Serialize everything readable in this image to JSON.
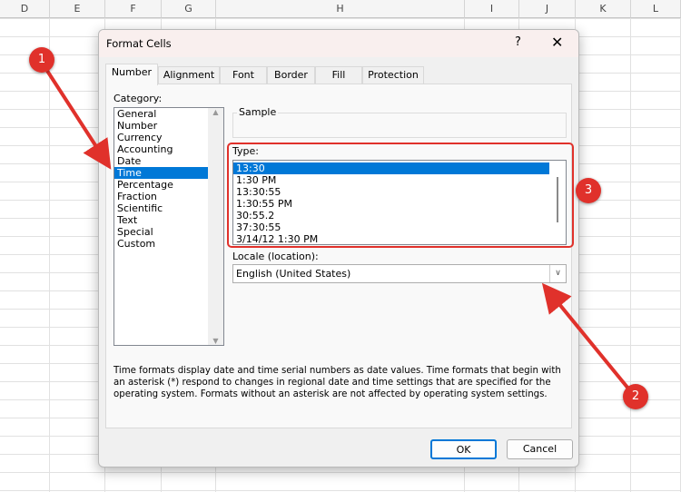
{
  "sheet": {
    "columns": [
      "D",
      "E",
      "F",
      "G",
      "H",
      "I",
      "J",
      "K",
      "L"
    ]
  },
  "dialog": {
    "title": "Format Cells",
    "help_label": "?",
    "close_label": "✕",
    "tabs": [
      {
        "label": "Number",
        "active": true
      },
      {
        "label": "Alignment"
      },
      {
        "label": "Font"
      },
      {
        "label": "Border"
      },
      {
        "label": "Fill"
      },
      {
        "label": "Protection"
      }
    ],
    "category_label": "Category:",
    "categories": [
      "General",
      "Number",
      "Currency",
      "Accounting",
      "Date",
      "Time",
      "Percentage",
      "Fraction",
      "Scientific",
      "Text",
      "Special",
      "Custom"
    ],
    "selected_category": "Time",
    "sample_label": "Sample",
    "type_label": "Type:",
    "types": [
      "13:30",
      "1:30 PM",
      "13:30:55",
      "1:30:55 PM",
      "30:55.2",
      "37:30:55",
      "3/14/12 1:30 PM"
    ],
    "selected_type": "13:30",
    "locale_label": "Locale (location):",
    "locale_value": "English (United States)",
    "description": "Time formats display date and time serial numbers as date values.  Time formats that begin with an asterisk (*) respond to changes in regional date and time settings that are specified for the operating system. Formats without an asterisk are not affected by operating system settings.",
    "ok_label": "OK",
    "cancel_label": "Cancel"
  },
  "annotations": [
    "1",
    "2",
    "3"
  ],
  "colors": {
    "accent": "#0078d7",
    "annotation": "#e0312b"
  }
}
